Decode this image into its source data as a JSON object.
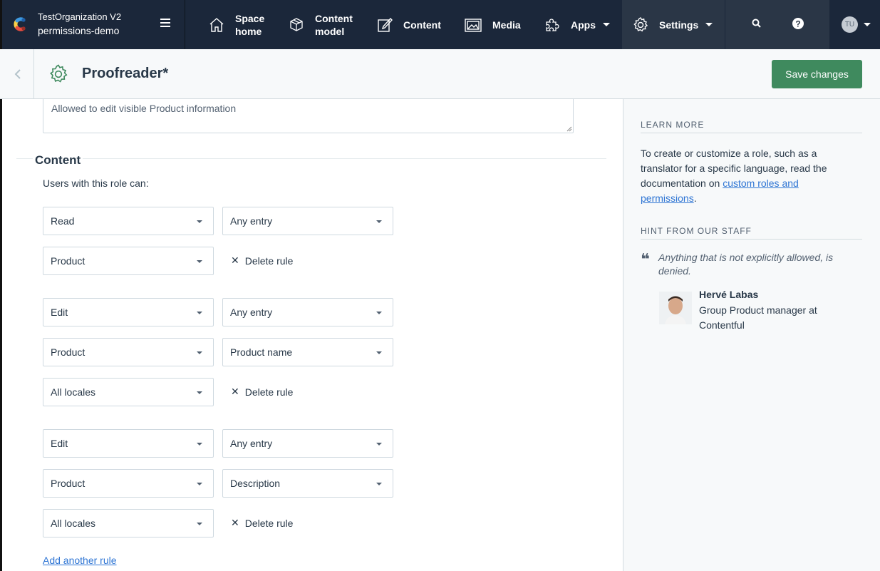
{
  "topbar": {
    "org_name": "TestOrganization V2",
    "space_name": "permissions-demo",
    "nav": [
      {
        "label_line1": "Space",
        "label_line2": "home",
        "icon": "home-icon"
      },
      {
        "label_line1": "Content",
        "label_line2": "model",
        "icon": "cube-icon"
      },
      {
        "label": "Content",
        "icon": "edit-icon"
      },
      {
        "label": "Media",
        "icon": "image-icon"
      },
      {
        "label": "Apps",
        "icon": "puzzle-icon"
      },
      {
        "label": "Settings",
        "icon": "gear-icon"
      }
    ],
    "avatar_initials": "TU"
  },
  "subheader": {
    "title": "Proofreader*",
    "save_label": "Save changes"
  },
  "main": {
    "description": "Allowed to edit visible Product information",
    "section_title": "Content",
    "intro": "Users with this role can:",
    "rules": [
      {
        "row1": [
          "Read",
          "Any entry"
        ],
        "row2": [
          "Product"
        ],
        "delete": "Delete rule"
      },
      {
        "row1": [
          "Edit",
          "Any entry"
        ],
        "row2": [
          "Product",
          "Product name"
        ],
        "row3": [
          "All locales"
        ],
        "delete": "Delete rule"
      },
      {
        "row1": [
          "Edit",
          "Any entry"
        ],
        "row2": [
          "Product",
          "Description"
        ],
        "row3": [
          "All locales"
        ],
        "delete": "Delete rule"
      }
    ],
    "add_rule": "Add another rule"
  },
  "sidebar": {
    "learn_heading": "LEARN MORE",
    "learn_text": "To create or customize a role, such as a translator for a specific language, read the documentation on ",
    "learn_link": "custom roles and permissions",
    "learn_end": ".",
    "hint_heading": "HINT FROM OUR STAFF",
    "quote": "Anything that is not explicitly allowed, is denied.",
    "staff_name": "Hervé Labas",
    "staff_role": "Group Product manager at Contentful"
  }
}
